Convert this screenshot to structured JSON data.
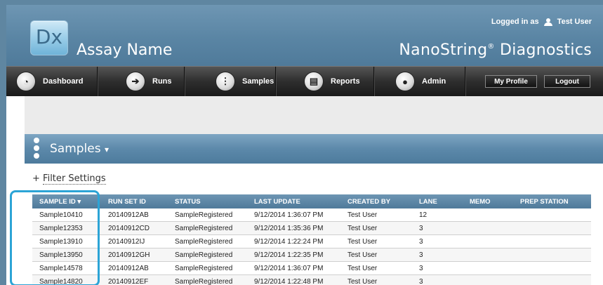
{
  "header": {
    "logo_text": "Dx",
    "assay_name": "Assay Name",
    "brand": "NanoString",
    "brand_mark": "®",
    "brand_suffix": " Diagnostics",
    "logged_in_label": "Logged in as",
    "user_name": "Test User"
  },
  "nav": {
    "items": [
      {
        "label": "Dashboard",
        "icon": "dashboard-icon"
      },
      {
        "label": "Runs",
        "icon": "arrow-right-icon"
      },
      {
        "label": "Samples",
        "icon": "samples-icon"
      },
      {
        "label": "Reports",
        "icon": "reports-icon"
      },
      {
        "label": "Admin",
        "icon": "user-icon"
      }
    ],
    "my_profile": "My Profile",
    "logout": "Logout"
  },
  "section": {
    "title": "Samples",
    "dropdown_glyph": "▾",
    "filter_prefix": "+",
    "filter_label": "Filter Settings"
  },
  "table": {
    "sort_glyph": "▾",
    "columns": [
      "SAMPLE ID",
      "RUN SET ID",
      "STATUS",
      "LAST UPDATE",
      "CREATED BY",
      "LANE",
      "MEMO",
      "PREP STATION"
    ],
    "rows": [
      [
        "Sample10410",
        "20140912AB",
        "SampleRegistered",
        "9/12/2014 1:36:07 PM",
        "Test User",
        "12",
        "",
        ""
      ],
      [
        "Sample12353",
        "20140912CD",
        "SampleRegistered",
        "9/12/2014 1:35:36 PM",
        "Test User",
        "3",
        "",
        ""
      ],
      [
        "Sample13910",
        "20140912IJ",
        "SampleRegistered",
        "9/12/2014 1:22:24 PM",
        "Test User",
        "3",
        "",
        ""
      ],
      [
        "Sample13950",
        "20140912GH",
        "SampleRegistered",
        "9/12/2014 1:22:35 PM",
        "Test User",
        "3",
        "",
        ""
      ],
      [
        "Sample14578",
        "20140912AB",
        "SampleRegistered",
        "9/12/2014 1:36:07 PM",
        "Test User",
        "3",
        "",
        ""
      ],
      [
        "Sample14820",
        "20140912EF",
        "SampleRegistered",
        "9/12/2014 1:22:48 PM",
        "Test User",
        "3",
        "",
        ""
      ]
    ]
  },
  "colors": {
    "header_blue": "#5a85a4",
    "highlight": "#2ca4d6",
    "nav_dark": "#2e2e2e"
  }
}
